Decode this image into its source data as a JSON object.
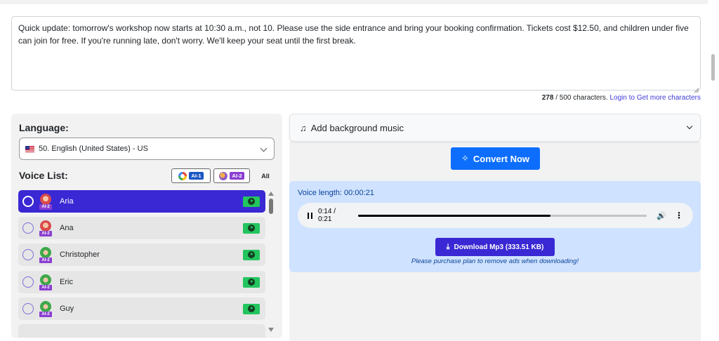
{
  "editor": {
    "text": "Quick update: tomorrow's workshop now starts at 10:30 a.m., not 10. Please use the side entrance and bring your booking confirmation. Tickets cost $12.50, and children under five can join for free. If you're running late, don't worry. We'll keep your seat until the first break.",
    "count": "278",
    "count_suffix": " / 500 characters.",
    "login_link": "Login to Get more characters"
  },
  "language": {
    "label": "Language:",
    "selected": "50. English (United States) - US"
  },
  "voices": {
    "label": "Voice List:",
    "filters": [
      {
        "badge": "AI-1"
      },
      {
        "badge": "AI-2"
      },
      {
        "label": "All"
      }
    ],
    "items": [
      {
        "name": "Aria",
        "tag": "AI-2",
        "gender": "female",
        "selected": true
      },
      {
        "name": "Ana",
        "tag": "AI-2",
        "gender": "female",
        "selected": false
      },
      {
        "name": "Christopher",
        "tag": "AI-2",
        "gender": "male",
        "selected": false
      },
      {
        "name": "Eric",
        "tag": "AI-2",
        "gender": "male",
        "selected": false
      },
      {
        "name": "Guy",
        "tag": "AI-2",
        "gender": "male",
        "selected": false
      }
    ]
  },
  "music": {
    "label": "Add background music"
  },
  "convert": {
    "label": "Convert Now"
  },
  "result": {
    "voice_length": "Voice length: 00:00:21",
    "player_time": "0:14 / 0:21",
    "progress_fraction": 0.667,
    "download_label": "Download Mp3 (333.51 KB)",
    "note": "Please purchase plan to remove ads when downloading!"
  },
  "icons": {
    "music": "music-note-icon",
    "convert": "sparkles-icon",
    "download": "download-icon",
    "pause": "pause-icon",
    "volume": "volume-icon",
    "more": "more-vertical-icon"
  },
  "colors": {
    "primary": "#0d6efd",
    "indigo": "#3a28d4",
    "play_green": "#22c55e",
    "result_bg": "#cfe2ff",
    "ai2_purple": "#8a3fd1"
  }
}
